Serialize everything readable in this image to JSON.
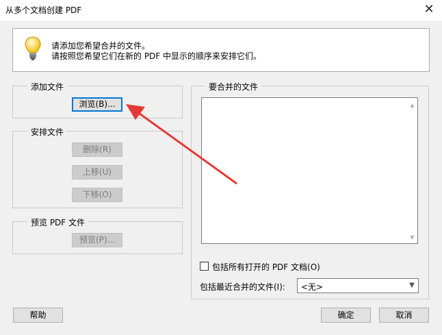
{
  "window": {
    "title": "从多个文档创建 PDF",
    "close_glyph": "✕"
  },
  "info": {
    "line1": "请添加您希望合并的文件。",
    "line2": "请按照您希望它们在新的 PDF 中显示的顺序来安排它们。"
  },
  "add_files": {
    "title": "添加文件",
    "browse_label": "浏览(B)..."
  },
  "arrange": {
    "title": "安排文件",
    "delete_label": "删除(R)",
    "move_up_label": "上移(U)",
    "move_down_label": "下移(O)"
  },
  "preview": {
    "title": "预览 PDF 文件",
    "preview_label": "预览(P)..."
  },
  "merge": {
    "title": "要合并的文件",
    "items": [],
    "include_open_label": "包括所有打开的 PDF 文档(O)",
    "include_open_checked": false,
    "recent_label": "包括最近合并的文件(I):",
    "recent_value": "<无>"
  },
  "footer": {
    "help_label": "帮助",
    "ok_label": "确定",
    "cancel_label": "取消"
  },
  "colors": {
    "focus": "#0078d7",
    "annotation": "#e53935"
  },
  "icons": {
    "info": "lightbulb-icon",
    "close": "close-icon",
    "select": "chevron-down-icon"
  }
}
